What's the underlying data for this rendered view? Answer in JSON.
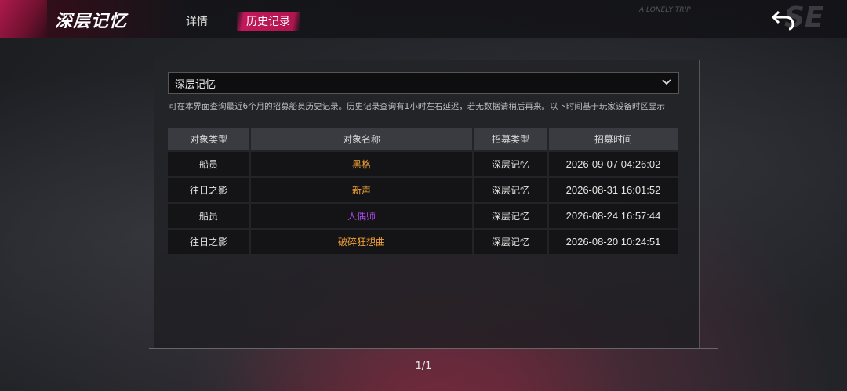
{
  "header": {
    "title": "深层记忆",
    "tabs": [
      {
        "label": "详情",
        "active": false
      },
      {
        "label": "历史记录",
        "active": true
      }
    ],
    "accent_color": "#c2185b",
    "back_icon": "back-arrow-icon"
  },
  "filter": {
    "selected": "深层记忆"
  },
  "note": "可在本界面查询最近6个月的招募船员历史记录。历史记录查询有1小时左右延迟，若无数据请稍后再来。以下时间基于玩家设备时区显示",
  "table": {
    "headers": [
      "对象类型",
      "对象名称",
      "招募类型",
      "招募时间"
    ],
    "rows": [
      {
        "type": "船员",
        "name": "黑格",
        "rarity": "gold",
        "recruit": "深层记忆",
        "time": "2026-09-07 04:26:02"
      },
      {
        "type": "往日之影",
        "name": "新声",
        "rarity": "gold",
        "recruit": "深层记忆",
        "time": "2026-08-31 16:01:52"
      },
      {
        "type": "船员",
        "name": "人偶师",
        "rarity": "purple",
        "recruit": "深层记忆",
        "time": "2026-08-24 16:57:44"
      },
      {
        "type": "往日之影",
        "name": "破碎狂想曲",
        "rarity": "gold",
        "recruit": "深层记忆",
        "time": "2026-08-20 10:24:51"
      }
    ],
    "rarity_colors": {
      "gold": "#f0a038",
      "purple": "#b44cf0"
    }
  },
  "pager": {
    "text": "1/1"
  }
}
